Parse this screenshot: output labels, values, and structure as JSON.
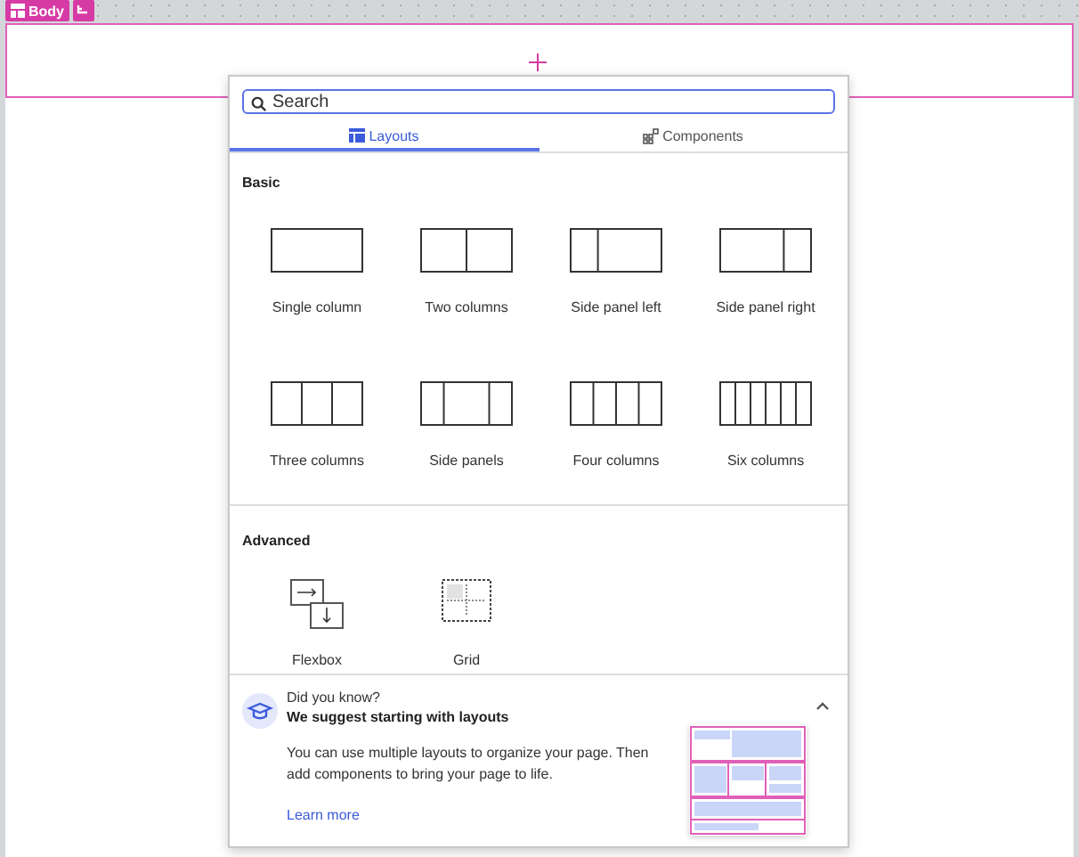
{
  "breadcrumb": {
    "label": "Body"
  },
  "search": {
    "placeholder": "Search"
  },
  "tabs": [
    {
      "label": "Layouts",
      "selected": true
    },
    {
      "label": "Components",
      "selected": false
    }
  ],
  "sections": [
    {
      "title": "Basic",
      "items": [
        {
          "label": "Single column",
          "kind": "single"
        },
        {
          "label": "Two columns",
          "kind": "two"
        },
        {
          "label": "Side panel left",
          "kind": "side-left"
        },
        {
          "label": "Side panel right",
          "kind": "side-right"
        },
        {
          "label": "Three columns",
          "kind": "three"
        },
        {
          "label": "Side panels",
          "kind": "side-panels"
        },
        {
          "label": "Four columns",
          "kind": "four"
        },
        {
          "label": "Six columns",
          "kind": "six"
        }
      ]
    },
    {
      "title": "Advanced",
      "items": [
        {
          "label": "Flexbox",
          "kind": "flexbox"
        },
        {
          "label": "Grid",
          "kind": "grid"
        }
      ]
    }
  ],
  "tip": {
    "eyebrow": "Did you know?",
    "title": "We suggest starting with layouts",
    "body": "You can use multiple layouts to organize your page. Then add components to bring your page to life.",
    "link": "Learn more",
    "expanded": true
  }
}
